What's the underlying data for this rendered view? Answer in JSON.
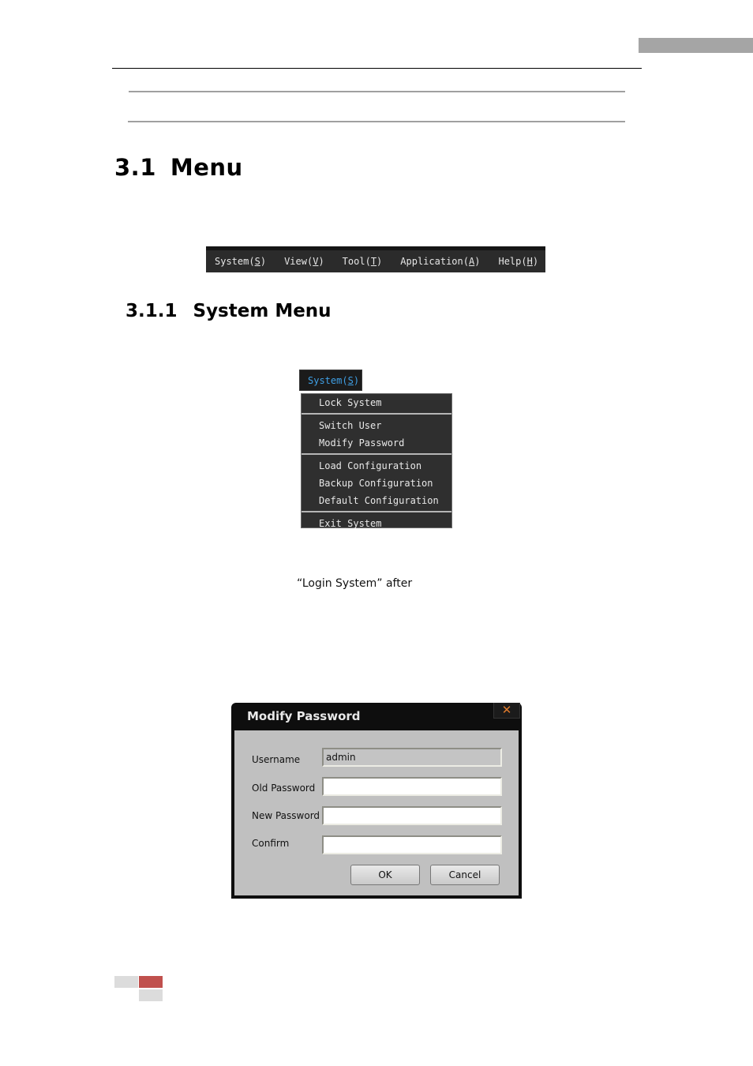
{
  "section": {
    "number": "3.1",
    "title": "Menu"
  },
  "menubar": {
    "items": [
      {
        "label": "System",
        "accel": "S"
      },
      {
        "label": "View",
        "accel": "V"
      },
      {
        "label": "Tool",
        "accel": "T"
      },
      {
        "label": "Application",
        "accel": "A"
      },
      {
        "label": "Help",
        "accel": "H"
      }
    ]
  },
  "subsection": {
    "number": "3.1.1",
    "title": "System Menu"
  },
  "system_menu": {
    "trigger": {
      "label": "System",
      "accel": "S"
    },
    "colors": {
      "trigger_text": "#3fa0e6",
      "menu_bg": "#2f2f2f"
    },
    "groups": [
      [
        "Lock System"
      ],
      [
        "Switch User",
        "Modify Password"
      ],
      [
        "Load Configuration",
        "Backup Configuration",
        "Default Configuration"
      ],
      [
        "Exit System"
      ]
    ]
  },
  "caption": "“Login System” after",
  "dialog": {
    "title": "Modify Password",
    "close_icon": "close-icon",
    "fields": {
      "username": {
        "label": "Username",
        "value": "admin"
      },
      "old_password": {
        "label": "Old Password",
        "value": ""
      },
      "new_password": {
        "label": "New Password",
        "value": ""
      },
      "confirm": {
        "label": "Confirm",
        "value": ""
      }
    },
    "ok_label": "OK",
    "cancel_label": "Cancel"
  },
  "footer": {
    "accent_color": "#c0504d"
  }
}
